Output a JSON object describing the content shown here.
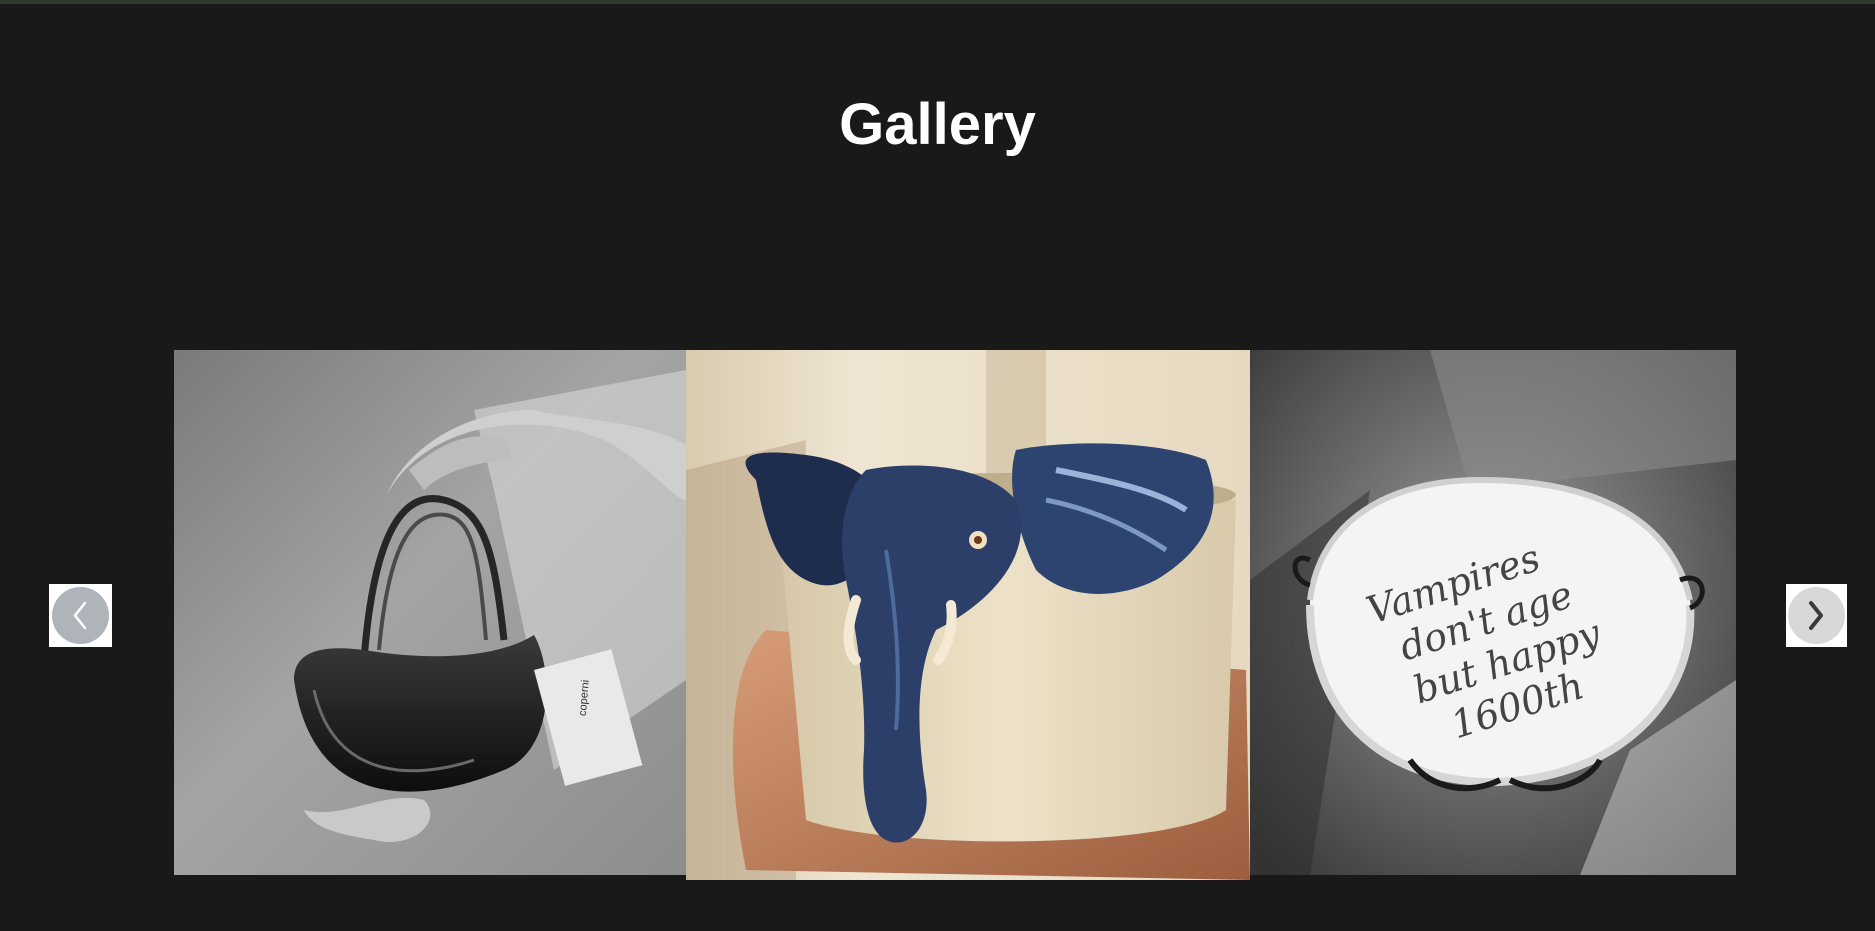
{
  "page": {
    "title": "Gallery"
  },
  "gallery": {
    "slides": [
      {
        "name": "glass-handbag-photo",
        "tag_text": "coperni"
      },
      {
        "name": "elephant-ceramic-cup-photo"
      },
      {
        "name": "cake-photo",
        "cake_text": [
          "Vampires",
          "don't age",
          "but happy",
          "1600th"
        ]
      }
    ],
    "prev_icon": "chevron-left-icon",
    "next_icon": "chevron-right-icon"
  },
  "colors": {
    "background": "#191919",
    "top_bar": "#2f3a2b",
    "title": "#ffffff",
    "prev_button_circle": "#aeb4ba",
    "next_button_circle": "#d8d8d8"
  }
}
